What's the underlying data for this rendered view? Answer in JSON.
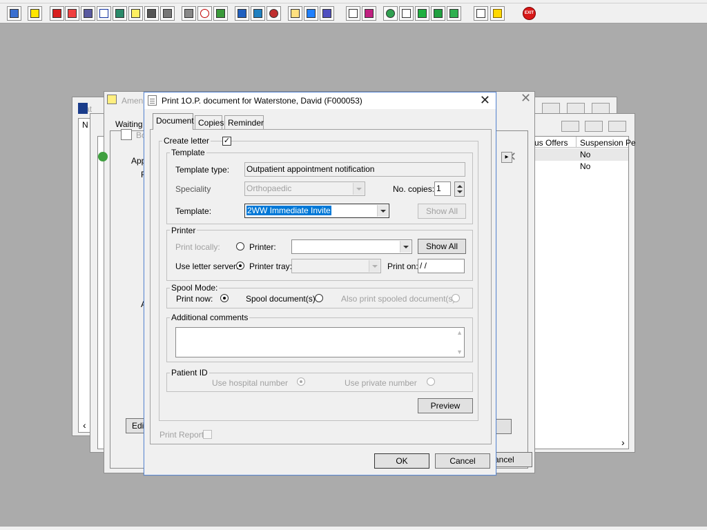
{
  "toolbar": {
    "buttons": [
      "patient-icon",
      "printer-icon",
      "book-icon",
      "edit-icon",
      "register-icon",
      "m-icon",
      "doctor-icon",
      "notes-icon",
      "ambulance-icon",
      "ward-icon",
      "bed-icon",
      "clock-icon",
      "monitor-icon",
      "report-icon",
      "form-icon",
      "scan-icon",
      "list-icon",
      "transfer-icon",
      "chair-icon",
      "document-icon",
      "chart-icon",
      "globe-icon",
      "mail-icon",
      "inbox-icon",
      "outbox-icon",
      "swap-icon",
      "warning-icon",
      "exit-icon"
    ],
    "exit_label": "EXIT"
  },
  "background": {
    "win1_title": "Pat",
    "win1_col": "N",
    "win2_title": "Amen",
    "win2_tab": "Waiting l",
    "win3_title": "Bo",
    "win3_tab": "App",
    "win3_group1": "F",
    "win3_group2": "A",
    "win3_button": "Edit",
    "bg_cancel": "ancel",
    "list_headers": [
      "us Offers",
      "Suspension Pe"
    ],
    "list_rows": [
      [
        "",
        "No"
      ],
      [
        "",
        "No"
      ]
    ]
  },
  "dialog": {
    "title": "Print 1O.P. document for Waterstone, David (F000053)",
    "tabs": [
      "Document",
      "Copies",
      "Reminder"
    ],
    "create_letter": "Create letter",
    "template_group": "Template",
    "template_type_label": "Template type:",
    "template_type_value": "Outpatient appointment notification",
    "speciality_label": "Speciality",
    "speciality_value": "Orthopaedic",
    "no_copies_label": "No. copies:",
    "no_copies_value": "1",
    "template_label": "Template:",
    "template_value": "2WW Immediate Invite",
    "show_all_1": "Show All",
    "printer_group": "Printer",
    "print_locally": "Print locally:",
    "printer_label": "Printer:",
    "printer_value": "",
    "show_all_2": "Show All",
    "use_letter_server": "Use letter server:",
    "printer_tray": "Printer tray:",
    "printer_tray_value": "",
    "print_on": "Print on:",
    "print_on_value": "/ /",
    "spool_group": "Spool Mode:",
    "print_now": "Print now:",
    "spool_documents": "Spool document(s)",
    "also_print": "Also print spooled document(s)",
    "additional_comments": "Additional comments",
    "patient_id_group": "Patient ID",
    "use_hospital_number": "Use hospital number",
    "use_private_number": "Use private number",
    "preview": "Preview",
    "print_report": "Print Report",
    "ok": "OK",
    "cancel": "Cancel"
  }
}
